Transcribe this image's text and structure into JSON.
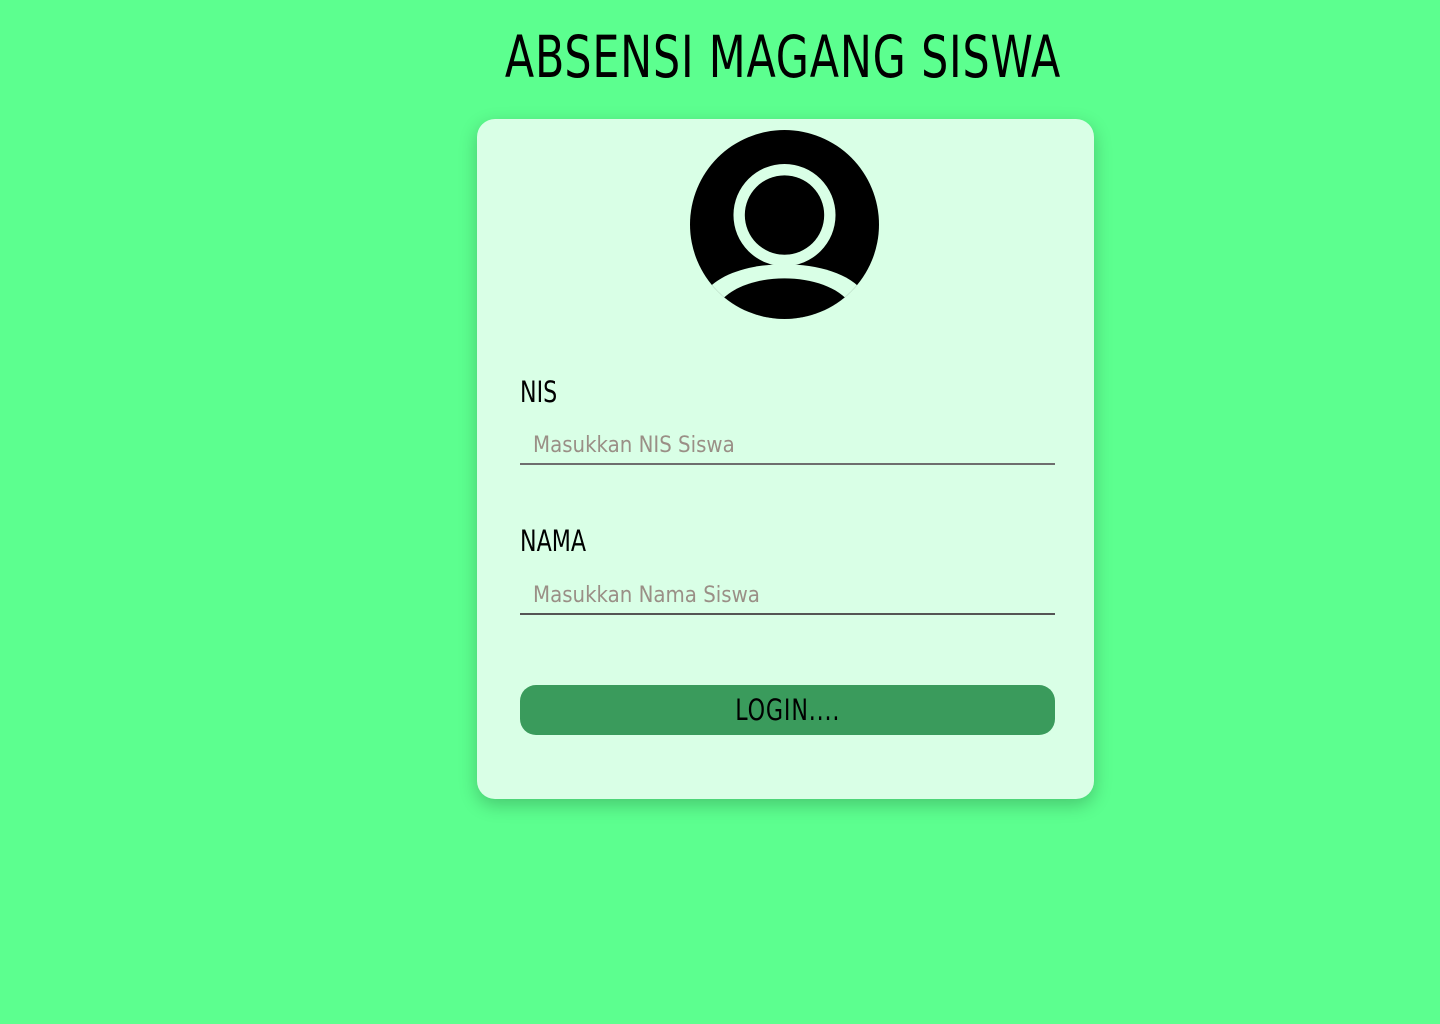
{
  "header": {
    "title": "ABSENSI MAGANG SISWA"
  },
  "login_form": {
    "avatar_icon": "user-circle-icon",
    "nis": {
      "label": "NIS",
      "placeholder": "Masukkan NIS Siswa",
      "value": ""
    },
    "nama": {
      "label": "NAMA",
      "placeholder": "Masukkan Nama Siswa",
      "value": ""
    },
    "submit_label": "LOGIN...."
  },
  "colors": {
    "page_background": "#5cff8f",
    "card_background": "#d9ffe6",
    "button_background": "#3a9b5c"
  }
}
